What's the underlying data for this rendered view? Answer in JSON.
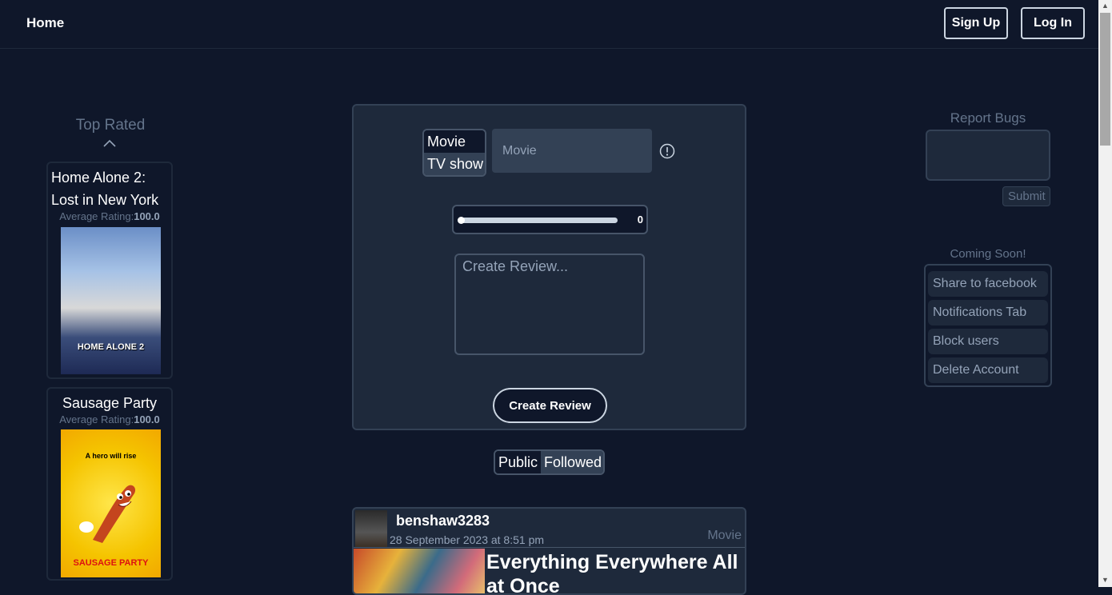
{
  "nav": {
    "home": "Home",
    "signup": "Sign Up",
    "login": "Log In"
  },
  "top_rated": {
    "title": "Top Rated",
    "items": [
      {
        "title": "Home Alone 2: Lost in New York",
        "rating_label": "Average Rating:",
        "rating": "100.0",
        "poster_text": "HOME ALONE 2"
      },
      {
        "title": "Sausage Party",
        "rating_label": "Average Rating:",
        "rating": "100.0",
        "poster_tagline": "A hero will rise",
        "poster_text": "SAUSAGE PARTY"
      }
    ]
  },
  "create": {
    "type_options": [
      "Movie",
      "TV show"
    ],
    "title_placeholder": "Movie",
    "rating_value": "0",
    "rating_fraction": 0,
    "review_placeholder": "Create Review...",
    "submit_label": "Create Review"
  },
  "feed": {
    "public": "Public",
    "followed": "Followed"
  },
  "post": {
    "user": "benshaw3283",
    "date": "28 September 2023 at 8:51 pm",
    "type": "Movie",
    "title": "Everything Everywhere All at Once"
  },
  "report": {
    "title": "Report Bugs",
    "submit": "Submit"
  },
  "coming_soon": {
    "title": "Coming Soon!",
    "items": [
      "Share to facebook",
      "Notifications Tab",
      "Block users",
      "Delete Account"
    ]
  },
  "colors": {
    "bg": "#0f172a",
    "panel": "#1e293b",
    "border": "#334155",
    "muted": "#64748b"
  }
}
